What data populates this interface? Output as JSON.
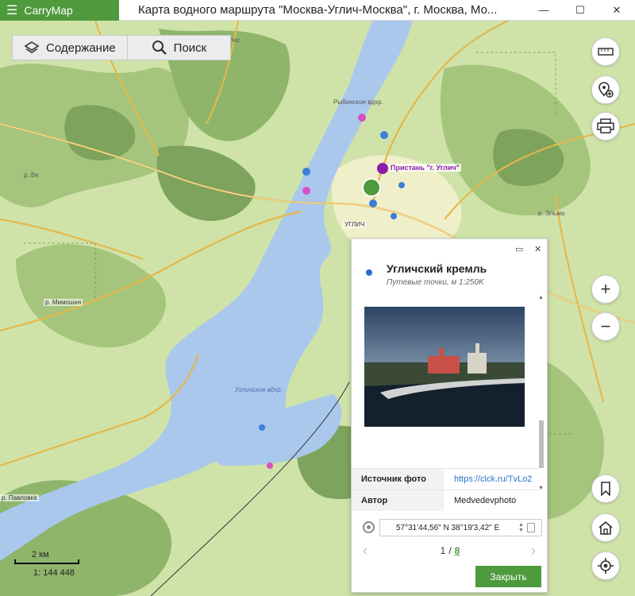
{
  "app": {
    "brand": "CarryMap",
    "window_title": "Карта водного маршрута \"Москва-Углич-Москва\", г. Москва, Мо..."
  },
  "window_controls": {
    "minimize": "—",
    "maximize": "☐",
    "close": "✕"
  },
  "toolbar": {
    "contents_label": "Содержание",
    "search_label": "Поиск"
  },
  "map": {
    "labels": {
      "top_road": "олес",
      "vdkhr1": "Рыбинское вдхр.",
      "pier": "Пристань \"г. Углич\"",
      "town": "УГЛИЧ",
      "vdkhr2": "Угличское вдхр.",
      "mimoshnya": "р. Мимошня",
      "pavlovka": "р. Павловка",
      "elma": "р. Эльма",
      "left_river": "р. Ве"
    },
    "colors": {
      "water": "#a9c8ec",
      "forest": "#a5c57c",
      "dark_forest": "#7da35c",
      "field": "#d8e8b3",
      "town": "#efefc9",
      "road": "#e4b84a"
    }
  },
  "scale": {
    "distance": "2 км",
    "ratio": "1: 144 448"
  },
  "right_buttons": [
    "ruler-icon",
    "add-point-icon",
    "printer-icon",
    "zoom-in-icon",
    "zoom-out-icon",
    "bookmark-icon",
    "home-icon",
    "my-location-icon"
  ],
  "panel": {
    "title": "Угличский кремль",
    "subtitle": "Путевые точки, м 1:250K",
    "attributes": [
      {
        "key": "Источник фото",
        "value": "https://clck.ru/TvLo2"
      },
      {
        "key": "Автор",
        "value": "Medvedevphoto"
      }
    ],
    "coordinates": "57°31'44,56\" N 38°19'3,42\" E",
    "page_current": "1",
    "page_sep": "/",
    "page_total": "8",
    "close_label": "Закрыть"
  }
}
